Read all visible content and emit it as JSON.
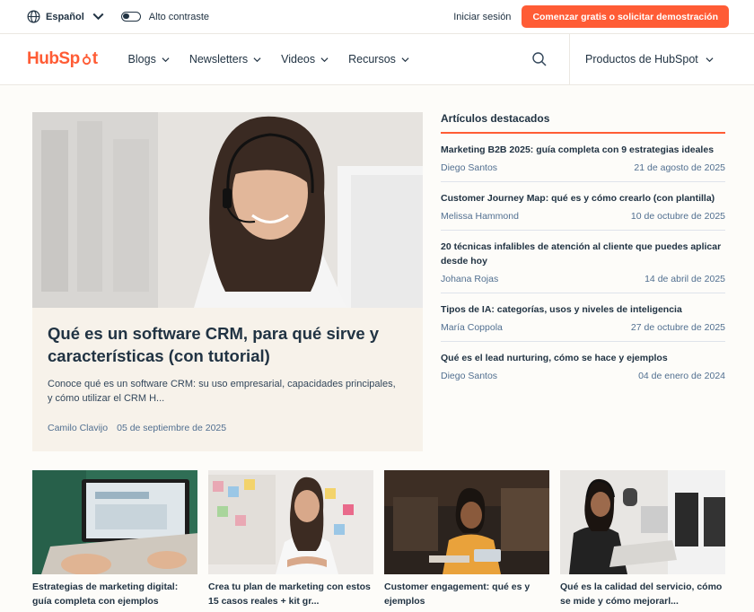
{
  "topbar": {
    "language": "Español",
    "contrast_label": "Alto contraste",
    "login": "Iniciar sesión",
    "cta": "Comenzar gratis o solicitar demostración"
  },
  "nav": {
    "logo": "HubSpot",
    "items": [
      {
        "label": "Blogs"
      },
      {
        "label": "Newsletters"
      },
      {
        "label": "Videos"
      },
      {
        "label": "Recursos"
      }
    ],
    "products": "Productos de HubSpot"
  },
  "hero": {
    "title": "Qué es un software CRM, para qué sirve y características (con tutorial)",
    "description": "Conoce qué es un software CRM: su uso empresarial, capacidades principales, y cómo utilizar el CRM H...",
    "author": "Camilo Clavijo",
    "date": "05 de septiembre de 2025"
  },
  "featured": {
    "heading": "Artículos destacados",
    "items": [
      {
        "title": "Marketing B2B 2025: guía completa con 9 estrategias ideales",
        "author": "Diego Santos",
        "date": "21 de agosto de 2025"
      },
      {
        "title": "Customer Journey Map: qué es y cómo crearlo (con plantilla)",
        "author": "Melissa Hammond",
        "date": "10 de octubre de 2025"
      },
      {
        "title": "20 técnicas infalibles de atención al cliente que puedes aplicar desde hoy",
        "author": "Johana Rojas",
        "date": "14 de abril de 2025"
      },
      {
        "title": "Tipos de IA: categorías, usos y niveles de inteligencia",
        "author": "María Coppola",
        "date": "27 de octubre de 2025"
      },
      {
        "title": "Qué es el lead nurturing, cómo se hace y ejemplos",
        "author": "Diego Santos",
        "date": "04 de enero de 2024"
      }
    ]
  },
  "cards": [
    {
      "title": "Estrategias de marketing digital: guía completa con ejemplos"
    },
    {
      "title": "Crea tu plan de marketing con estos 15 casos reales + kit gr..."
    },
    {
      "title": "Customer engagement: qué es y ejemplos"
    },
    {
      "title": "Qué es la calidad del servicio, cómo se mide y cómo mejorarl..."
    }
  ],
  "colors": {
    "accent": "#ff5c35",
    "text": "#213343",
    "hero_bg": "#f7f2ea"
  }
}
